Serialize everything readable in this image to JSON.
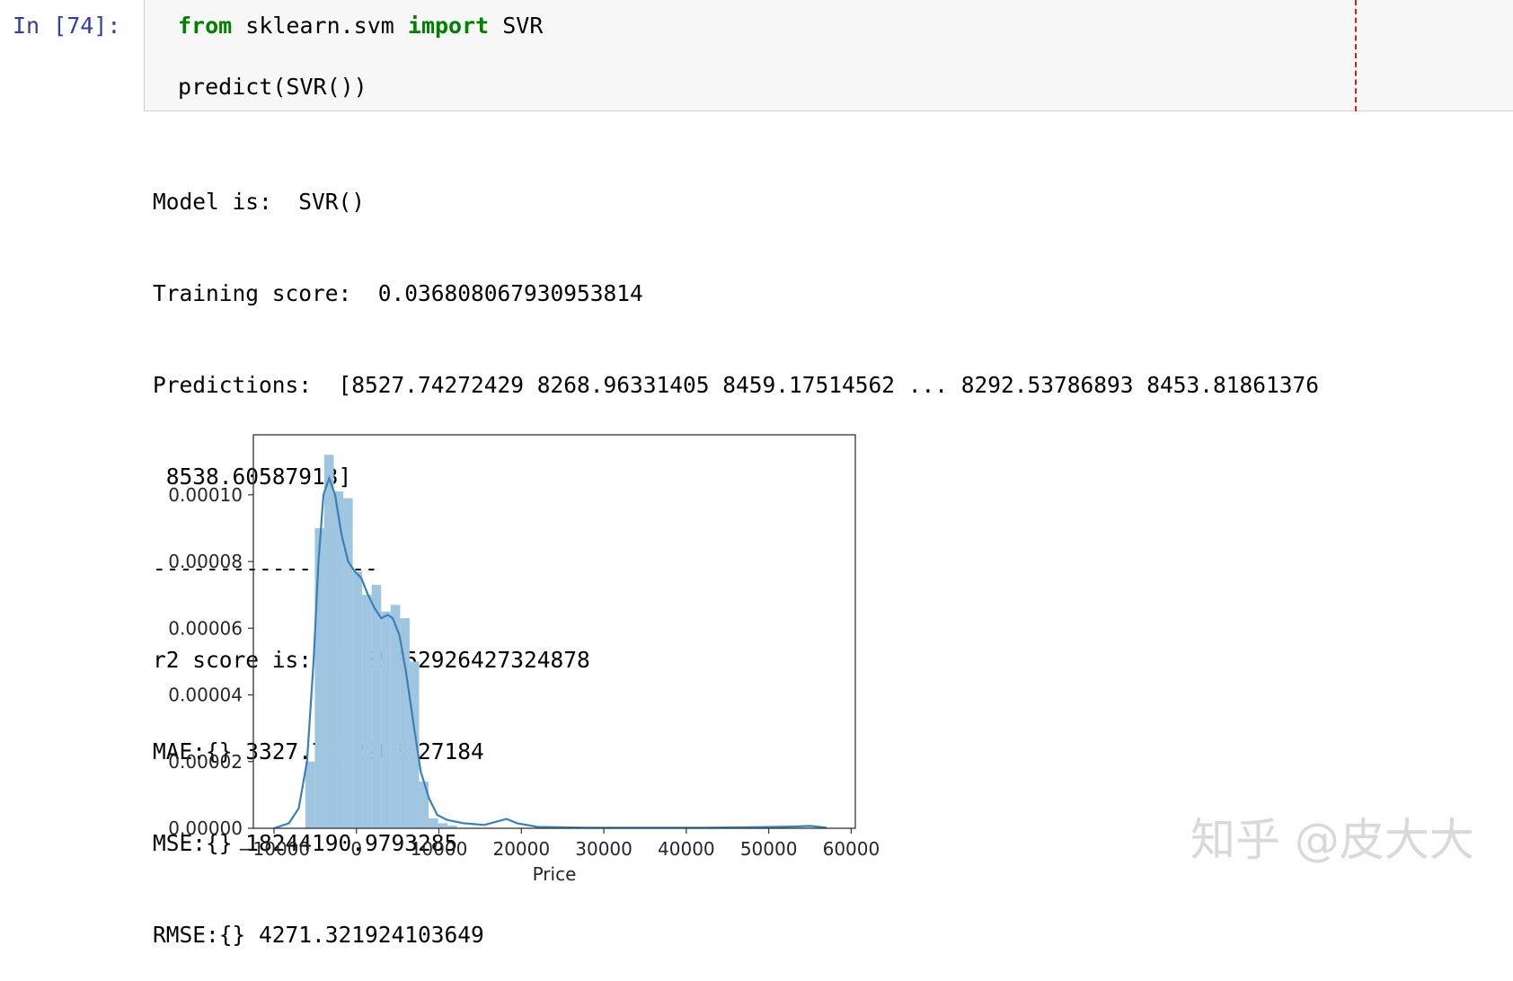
{
  "cell": {
    "prompt": "In [74]:",
    "code": {
      "line1": {
        "kw1": "from",
        "mid": " sklearn.svm ",
        "kw2": "import",
        "tail": " SVR"
      },
      "line2": "predict(SVR())"
    }
  },
  "output": {
    "lines": [
      "Model is:  SVR()",
      "Training score:  0.036808067930953814",
      "Predictions:  [8527.74272429 8268.96331405 8459.17514562 ... 8292.53786893 8453.81861376",
      " 8538.60587913]",
      "-----------------",
      "r2 score is:  0.05252926427324878",
      "MAE:{} 3327.7462262427184",
      "MSE:{} 18244190.9793285",
      "RMSE:{} 4271.321924103649"
    ]
  },
  "chart_data": {
    "type": "bar",
    "xlabel": "Price",
    "ylabel": "",
    "xlim": [
      -12500,
      60500
    ],
    "ylim": [
      0,
      0.000118
    ],
    "xticks": [
      -10000,
      0,
      10000,
      20000,
      30000,
      40000,
      50000,
      60000
    ],
    "xtick_labels": [
      "−10000",
      "0",
      "10000",
      "20000",
      "30000",
      "40000",
      "50000",
      "60000"
    ],
    "yticks": [
      0,
      2e-05,
      4e-05,
      6e-05,
      8e-05,
      0.0001
    ],
    "ytick_labels": [
      "0.00000",
      "0.00002",
      "0.00004",
      "0.00006",
      "0.00008",
      "0.00010"
    ],
    "bar_color": "#9fc5e0",
    "line_color": "#3a80b8",
    "bins": [
      {
        "x0": -6200,
        "x1": -5050,
        "value": 2e-05
      },
      {
        "x0": -5050,
        "x1": -3900,
        "value": 9e-05
      },
      {
        "x0": -3900,
        "x1": -2750,
        "value": 0.000112
      },
      {
        "x0": -2750,
        "x1": -1600,
        "value": 0.000101
      },
      {
        "x0": -1600,
        "x1": -450,
        "value": 9.9e-05
      },
      {
        "x0": -450,
        "x1": 700,
        "value": 7.7e-05
      },
      {
        "x0": 700,
        "x1": 1850,
        "value": 7e-05
      },
      {
        "x0": 1850,
        "x1": 3000,
        "value": 7.3e-05
      },
      {
        "x0": 3000,
        "x1": 4150,
        "value": 6.5e-05
      },
      {
        "x0": 4150,
        "x1": 5300,
        "value": 6.7e-05
      },
      {
        "x0": 5300,
        "x1": 6450,
        "value": 6.3e-05
      },
      {
        "x0": 6450,
        "x1": 7600,
        "value": 5e-05
      },
      {
        "x0": 7600,
        "x1": 8750,
        "value": 1.4e-05
      },
      {
        "x0": 8750,
        "x1": 9900,
        "value": 3e-06
      },
      {
        "x0": 9900,
        "x1": 11050,
        "value": 1.5e-06
      },
      {
        "x0": 11050,
        "x1": 12200,
        "value": 8e-07
      }
    ],
    "kde": [
      [
        -10000,
        0
      ],
      [
        -8200,
        1.5e-06
      ],
      [
        -7000,
        6e-06
      ],
      [
        -6000,
        2e-05
      ],
      [
        -5200,
        5e-05
      ],
      [
        -4600,
        8e-05
      ],
      [
        -4000,
        0.0001
      ],
      [
        -3300,
        0.000105
      ],
      [
        -2600,
        0.0001
      ],
      [
        -1800,
        8.8e-05
      ],
      [
        -1000,
        8e-05
      ],
      [
        -200,
        7.7e-05
      ],
      [
        600,
        7.5e-05
      ],
      [
        1400,
        7e-05
      ],
      [
        2200,
        6.6e-05
      ],
      [
        3000,
        6.3e-05
      ],
      [
        3800,
        6.4e-05
      ],
      [
        4400,
        6.3e-05
      ],
      [
        5200,
        5.8e-05
      ],
      [
        6000,
        4.7e-05
      ],
      [
        7000,
        3e-05
      ],
      [
        7800,
        1.7e-05
      ],
      [
        8800,
        9e-06
      ],
      [
        9800,
        4e-06
      ],
      [
        11000,
        2.5e-06
      ],
      [
        13000,
        1.5e-06
      ],
      [
        15500,
        1e-06
      ],
      [
        17000,
        2e-06
      ],
      [
        18200,
        2.8e-06
      ],
      [
        19500,
        1.5e-06
      ],
      [
        22000,
        4e-07
      ],
      [
        28000,
        1.5e-07
      ],
      [
        35000,
        2e-07
      ],
      [
        42000,
        1.5e-07
      ],
      [
        48000,
        3e-07
      ],
      [
        53000,
        5e-07
      ],
      [
        55000,
        7e-07
      ],
      [
        57000,
        2e-07
      ]
    ]
  },
  "watermark": "知乎 @皮大大"
}
